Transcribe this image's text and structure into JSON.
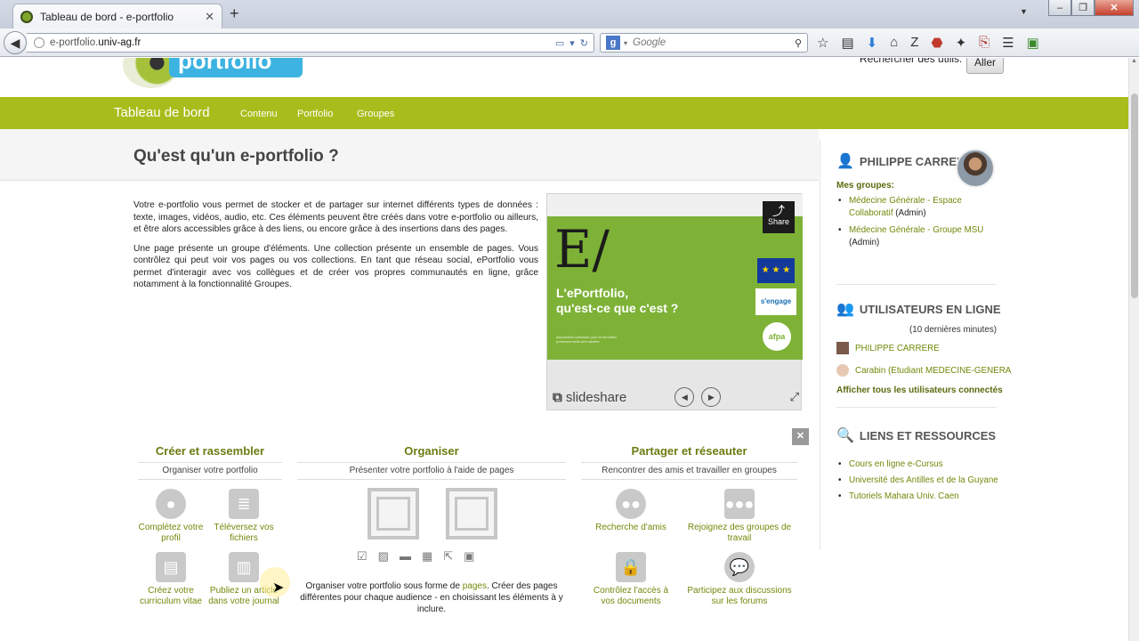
{
  "browser": {
    "tab_title": "Tableau de bord - e-portfolio",
    "url_prefix": "e-portfolio.",
    "url_domain": "univ-ag.fr",
    "search_placeholder": "Google",
    "search_engine_icon": "g-icon"
  },
  "header": {
    "logo_text": "portfolio",
    "user_search_label": "Rechercher des utilis.",
    "user_search_button": "Aller"
  },
  "nav": {
    "dashboard": "Tableau de bord",
    "items": [
      "Contenu",
      "Portfolio",
      "Groupes"
    ]
  },
  "main": {
    "title": "Qu'est qu'un e-portfolio ?",
    "intro_p1": "Votre e-portfolio vous permet de stocker et de partager sur internet différents types de données : texte, images, vidéos, audio, etc. Ces éléments peuvent être créés dans votre e-portfolio ou ailleurs, et être alors accessibles grâce à des liens, ou encore grâce à des insertions dans des pages.",
    "intro_p2": "Une page présente un groupe d'éléments. Une collection présente un ensemble de pages. Vous contrôlez qui peut voir vos pages ou vos collections. En tant que réseau social, ePortfolio vous permet d'interagir avec vos collègues et de créer vos propres communautés en ligne, grâce notamment à la fonctionnalité Groupes."
  },
  "slideshow": {
    "letter": "E/",
    "title_line1": "L'ePortfolio,",
    "title_line2": "qu'est-ce que c'est ?",
    "small_text": "association nationale pour la formation professionnelle des adultes",
    "share_label": "Share",
    "brand_light": "slide",
    "brand_bold": "share",
    "badge_engage": "s'engage",
    "badge_afpa": "afpa"
  },
  "sidebar": {
    "user_name": "PHILIPPE CARRERE",
    "groups_label": "Mes groupes:",
    "groups": [
      {
        "name": "Médecine Générale - Espace Collaboratif",
        "role": "(Admin)"
      },
      {
        "name": "Médecine Générale - Groupe MSU",
        "role": "(Admin)"
      }
    ],
    "online_title": "UTILISATEURS EN LIGNE",
    "online_note": "(10 dernières minutes)",
    "online_users": [
      "PHILIPPE CARRERE",
      "Carabin (Etudiant MEDECINE-GENERA"
    ],
    "online_more": "Afficher tous les utilisateurs connectés",
    "links_title": "LIENS ET RESSOURCES",
    "links": [
      "Cours en ligne e-Cursus",
      "Université des Antilles et de la Guyane",
      "Tutoriels Mahara Univ. Caen"
    ]
  },
  "features": {
    "create": {
      "title": "Créer et rassembler",
      "subtitle": "Organiser votre portfolio",
      "items": [
        "Complétez votre profil",
        "Téléversez vos fichiers",
        "Créez votre curriculum vitae",
        "Publiez un article dans votre journal"
      ]
    },
    "organize": {
      "title": "Organiser",
      "subtitle": "Présenter votre portfolio à l'aide de pages",
      "text_before": "Organiser votre portfolio sous forme de ",
      "text_link": "pages",
      "text_after": ". Créer des pages différentes pour chaque audience - en choisissant les éléments à y inclure."
    },
    "share": {
      "title": "Partager et réseauter",
      "subtitle": "Rencontrer des amis et travailler en groupes",
      "items": [
        "Recherche d'amis",
        "Rejoignez des groupes de travail",
        "Contrôlez l'accès à vos documents",
        "Participez aux discussions sur les forums"
      ]
    }
  }
}
